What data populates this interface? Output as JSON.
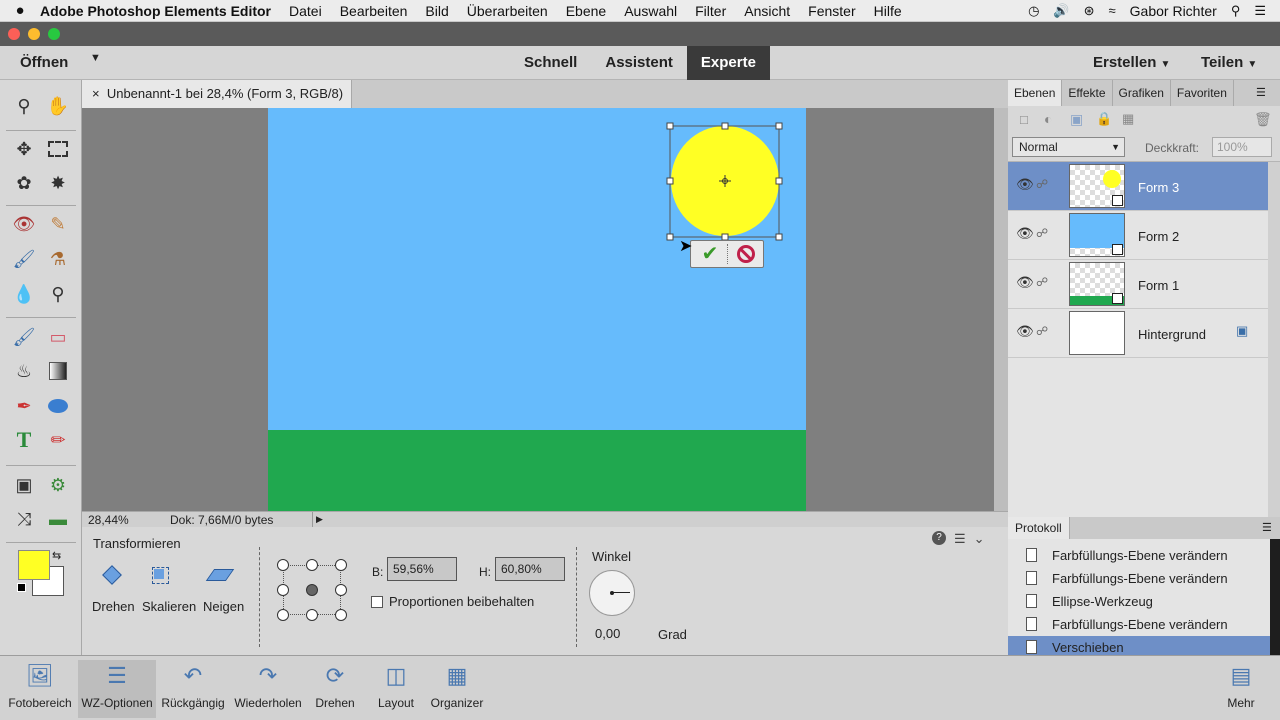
{
  "menubar": {
    "app": "Adobe Photoshop Elements Editor",
    "items": [
      "Datei",
      "Bearbeiten",
      "Bild",
      "Überarbeiten",
      "Ebene",
      "Auswahl",
      "Filter",
      "Ansicht",
      "Fenster",
      "Hilfe"
    ],
    "user": "Gabor Richter"
  },
  "modebar": {
    "open": "Öffnen",
    "tabs": [
      "Schnell",
      "Assistent",
      "Experte"
    ],
    "create": "Erstellen",
    "share": "Teilen"
  },
  "document": {
    "tab": "Unbenannt-1 bei 28,4% (Form 3, RGB/8) *",
    "zoom": "28,44%",
    "size": "Dok: 7,66M/0 bytes"
  },
  "colors": {
    "sky": "#66bbfc",
    "grass": "#20a84f",
    "sun": "#ffff24",
    "selection": "#6e8fc7",
    "foreground": "#ffff24",
    "background": "#ffffff"
  },
  "options": {
    "title": "Transformieren",
    "modes": [
      "Drehen",
      "Skalieren",
      "Neigen"
    ],
    "w_label": "B:",
    "w_value": "59,56%",
    "h_label": "H:",
    "h_value": "60,80%",
    "proportions": "Proportionen beibehalten",
    "angle_label": "Winkel",
    "angle_value": "0,00",
    "angle_unit": "Grad"
  },
  "panels": {
    "tabs": [
      "Ebenen",
      "Effekte",
      "Grafiken",
      "Favoriten"
    ],
    "blend_mode": "Normal",
    "opacity_label": "Deckkraft:",
    "opacity_value": "100%",
    "layers": [
      "Form 3",
      "Form 2",
      "Form 1",
      "Hintergrund"
    ],
    "protocol_tab": "Protokoll",
    "history": [
      "Farbfüllungs-Ebene verändern",
      "Farbfüllungs-Ebene verändern",
      "Ellipse-Werkzeug",
      "Farbfüllungs-Ebene verändern",
      "Verschieben"
    ]
  },
  "taskbar": {
    "items": [
      "Fotobereich",
      "WZ-Optionen",
      "Rückgängig",
      "Wiederholen",
      "Drehen",
      "Layout",
      "Organizer"
    ],
    "more": "Mehr"
  }
}
